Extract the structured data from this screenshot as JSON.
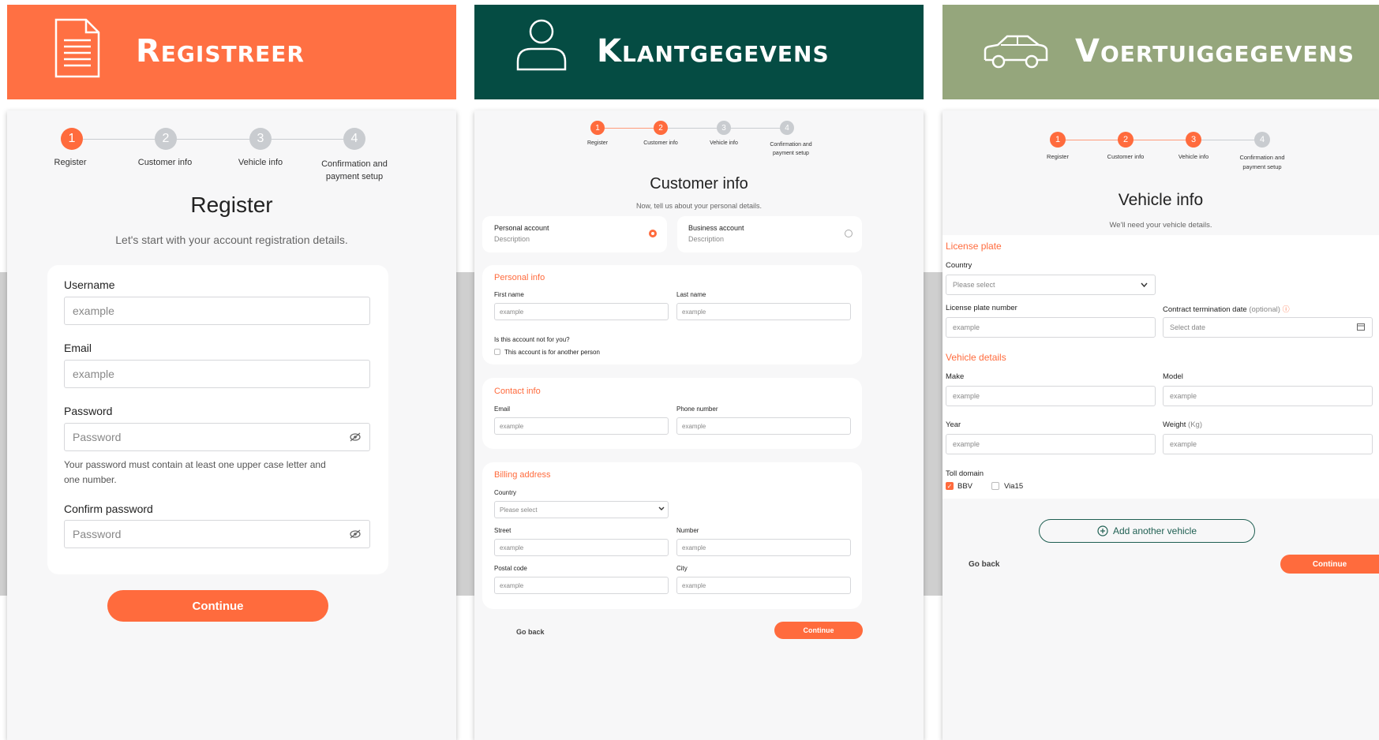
{
  "colors": {
    "orange": "#ff7043",
    "dark_green": "#054c43",
    "sage": "#95a67c",
    "accent": "#ff6b3d"
  },
  "stepper_labels": [
    "Register",
    "Customer info",
    "Vehicle info"
  ],
  "stepper_confirm": [
    "Confirmation and",
    "payment setup"
  ],
  "panel1": {
    "banner_title": "Registreer",
    "banner_icon": "document-icon",
    "steps": [
      "1",
      "2",
      "3",
      "4"
    ],
    "title": "Register",
    "subtitle": "Let's start with your account registration details.",
    "username_label": "Username",
    "username_placeholder": "example",
    "email_label": "Email",
    "email_placeholder": "example",
    "password_label": "Password",
    "password_placeholder": "Password",
    "password_hint_1": "Your password must contain at least one upper case letter and",
    "password_hint_2": "one number.",
    "confirm_label": "Confirm password",
    "confirm_placeholder": "Password",
    "continue": "Continue"
  },
  "panel2": {
    "banner_title": "Klantgegevens",
    "banner_icon": "person-icon",
    "steps": [
      "1",
      "2",
      "3",
      "4"
    ],
    "title": "Customer info",
    "subtitle": "Now, tell us about your personal details.",
    "personal_account": "Personal account",
    "personal_desc": "Description",
    "business_account": "Business account",
    "business_desc": "Description",
    "personal_info": "Personal info",
    "first_name": "First name",
    "last_name": "Last name",
    "placeholder": "example",
    "not_for_you": "Is this account not for you?",
    "another_person": "This account is for another person",
    "contact_info": "Contact info",
    "email": "Email",
    "phone": "Phone number",
    "billing": "Billing address",
    "country": "Country",
    "please_select": "Please select",
    "street": "Street",
    "number": "Number",
    "postal": "Postal code",
    "city": "City",
    "go_back": "Go back",
    "continue": "Continue"
  },
  "panel3": {
    "banner_title": "Voertuiggegevens",
    "banner_icon": "car-icon",
    "steps": [
      "1",
      "2",
      "3",
      "4"
    ],
    "title": "Vehicle info",
    "subtitle": "We'll need your vehicle details.",
    "license_plate": "License plate",
    "country": "Country",
    "please_select": "Please select",
    "plate_number": "License plate number",
    "termination": "Contract termination date",
    "optional": "(optional)",
    "select_date": "Select date",
    "placeholder": "example",
    "vehicle_details": "Vehicle details",
    "make": "Make",
    "model": "Model",
    "year": "Year",
    "weight": "Weight",
    "weight_unit": "(Kg)",
    "toll_domain": "Toll domain",
    "toll_bbv": "BBV",
    "toll_via": "Via15",
    "add_vehicle": "Add another vehicle",
    "go_back": "Go back",
    "continue": "Continue"
  }
}
